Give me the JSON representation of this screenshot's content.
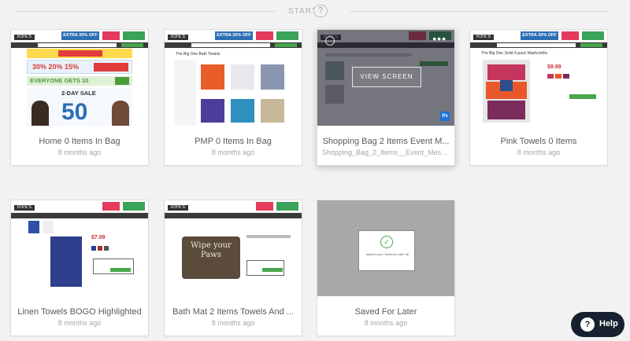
{
  "header": {
    "start_label": "START",
    "help_glyph": "?"
  },
  "cards": [
    {
      "title": "Home 0 Items In Bag",
      "subtitle": "8 months ago",
      "thumb": {
        "promo": "EXTRA 20% OFF",
        "banner1": "30% 20% 15%",
        "banner2": "EVERYONE GETS 10",
        "banner3": "2-DAY SALE",
        "big": "50"
      }
    },
    {
      "title": "PMP 0 Items In Bag",
      "subtitle": "8 months ago",
      "thumb": {
        "promo": "EXTRA 20% OFF",
        "heading": "The Big One Bath Towels"
      }
    },
    {
      "title": "Shopping Bag 2 Items Event M...",
      "subtitle": "Shopping_Bag_2_Items__Event_Messag...",
      "hover": {
        "button": "VIEW SCREEN",
        "dots": "•••",
        "badge": "Ps"
      }
    },
    {
      "title": "Pink Towels 0 Items",
      "subtitle": "8 months ago",
      "thumb": {
        "promo": "EXTRA 20% OFF",
        "heading": "The Big One Solid 6-pack Washcloths",
        "price": "$9.99"
      }
    },
    {
      "title": "Linen Towels BOGO Highlighted",
      "subtitle": "8 months ago",
      "thumb": {
        "price": "$7.99"
      }
    },
    {
      "title": "Bath Mat 2 Items Towels And ...",
      "subtitle": "8 months ago",
      "thumb": {
        "mat_text": "Wipe your Paws"
      }
    },
    {
      "title": "Saved For Later",
      "subtitle": "8 months ago",
      "thumb": {
        "dialog_text": "Added to your \"Saved for Later\" list",
        "check": "✓"
      }
    }
  ],
  "help": {
    "label": "Help",
    "icon": "?"
  },
  "colors": {
    "accent": "#16202f",
    "kohls_blue": "#2c6fb5",
    "kohls_green": "#48a64c"
  }
}
